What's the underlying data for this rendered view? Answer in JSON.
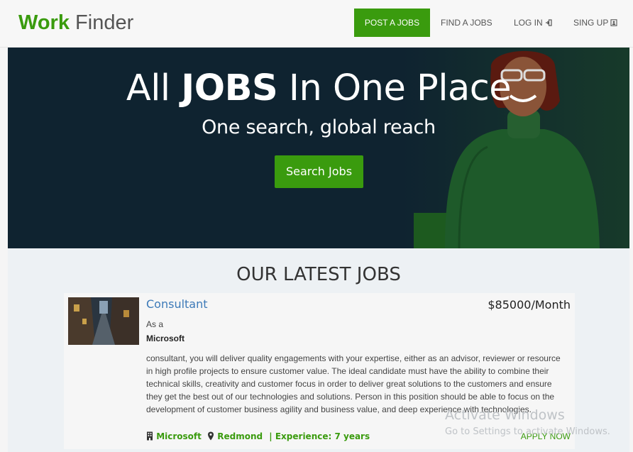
{
  "navbar": {
    "brand_word1": "Work",
    "brand_word2": "Finder",
    "post_jobs": "POST A JOBS",
    "find_jobs": "FIND A JOBS",
    "log_in": "LOG IN",
    "sign_up": "SING UP",
    "icons": {
      "log_in": "sign-in-icon",
      "sign_up": "user-card-icon"
    },
    "colors": {
      "brand_green": "#3a9b0e",
      "background": "#f7f7f7"
    }
  },
  "hero": {
    "title_part1": "All ",
    "title_bold": "JOBS",
    "title_part2": " In One Place",
    "subtitle": "One search, global reach",
    "button": "Search Jobs",
    "colors": {
      "background": "#0f2330",
      "button": "#3a9b0e"
    }
  },
  "latest": {
    "heading": "OUR LATEST JOBS",
    "jobs": [
      {
        "title": "Consultant",
        "salary": "$85000/Month",
        "intro": "As a",
        "company": "Microsoft",
        "description": " consultant, you will deliver quality engagements with your expertise, either as an advisor, reviewer or resource in high profile projects to ensure customer value. The ideal candidate must have the ability to combine their technical skills, creativity and customer focus in order to deliver great solutions to the customers and ensure they get the best out of our technologies and solutions. Person in this position should be able to focus on the development of customer business agility and business value, and deep experience with technologies.",
        "meta_company": "Microsoft",
        "meta_location": "Redmond",
        "meta_experience": "| Experience: 7 years",
        "apply": "APPLY NOW",
        "icons": {
          "company": "building-icon",
          "location": "map-marker-icon"
        }
      }
    ]
  },
  "watermark": {
    "line1": "Activate Windows",
    "line2": "Go to Settings to activate Windows."
  }
}
